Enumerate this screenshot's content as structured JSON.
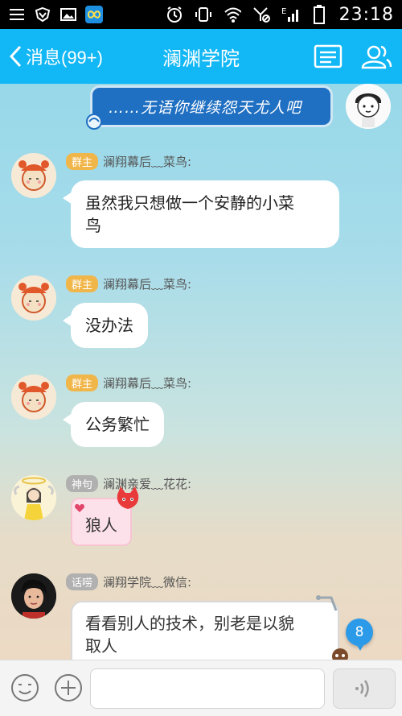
{
  "status_bar": {
    "time": "23:18",
    "icons": [
      "menu-icon",
      "shield-icon",
      "image-icon",
      "infinity-app-icon",
      "alarm-icon",
      "vibrate-icon",
      "wifi-icon",
      "no-signal-icon",
      "signal-e-icon",
      "battery-icon"
    ]
  },
  "header": {
    "back_label": "消息(99+)",
    "title": "澜渊学院",
    "accent": "#12b7f5"
  },
  "messages": [
    {
      "kind": "self-bubble",
      "text": "……无语你继续怨天尤人吧"
    },
    {
      "badge": "群主",
      "badge_color": "#f0b64a",
      "sender": "澜翔幕后﹏菜鸟:",
      "lines": [
        "虽然我只想做一个安静的小菜",
        "鸟"
      ]
    },
    {
      "badge": "群主",
      "badge_color": "#f0b64a",
      "sender": "澜翔幕后﹏菜鸟:",
      "lines": [
        "没办法"
      ]
    },
    {
      "badge": "群主",
      "badge_color": "#f0b64a",
      "sender": "澜翔幕后﹏菜鸟:",
      "lines": [
        "公务繁忙"
      ]
    },
    {
      "badge": "神句",
      "badge_color": "#b0b0b0",
      "sender": "澜渊亲爱﹏花花:",
      "lines": [
        "狼人"
      ]
    },
    {
      "badge": "话唠",
      "badge_color": "#b0b0b0",
      "sender": "澜翔学院﹏微信:",
      "lines": [
        "看看别人的技术，别老是以貌",
        "取人"
      ]
    }
  ],
  "unread_count": "8"
}
